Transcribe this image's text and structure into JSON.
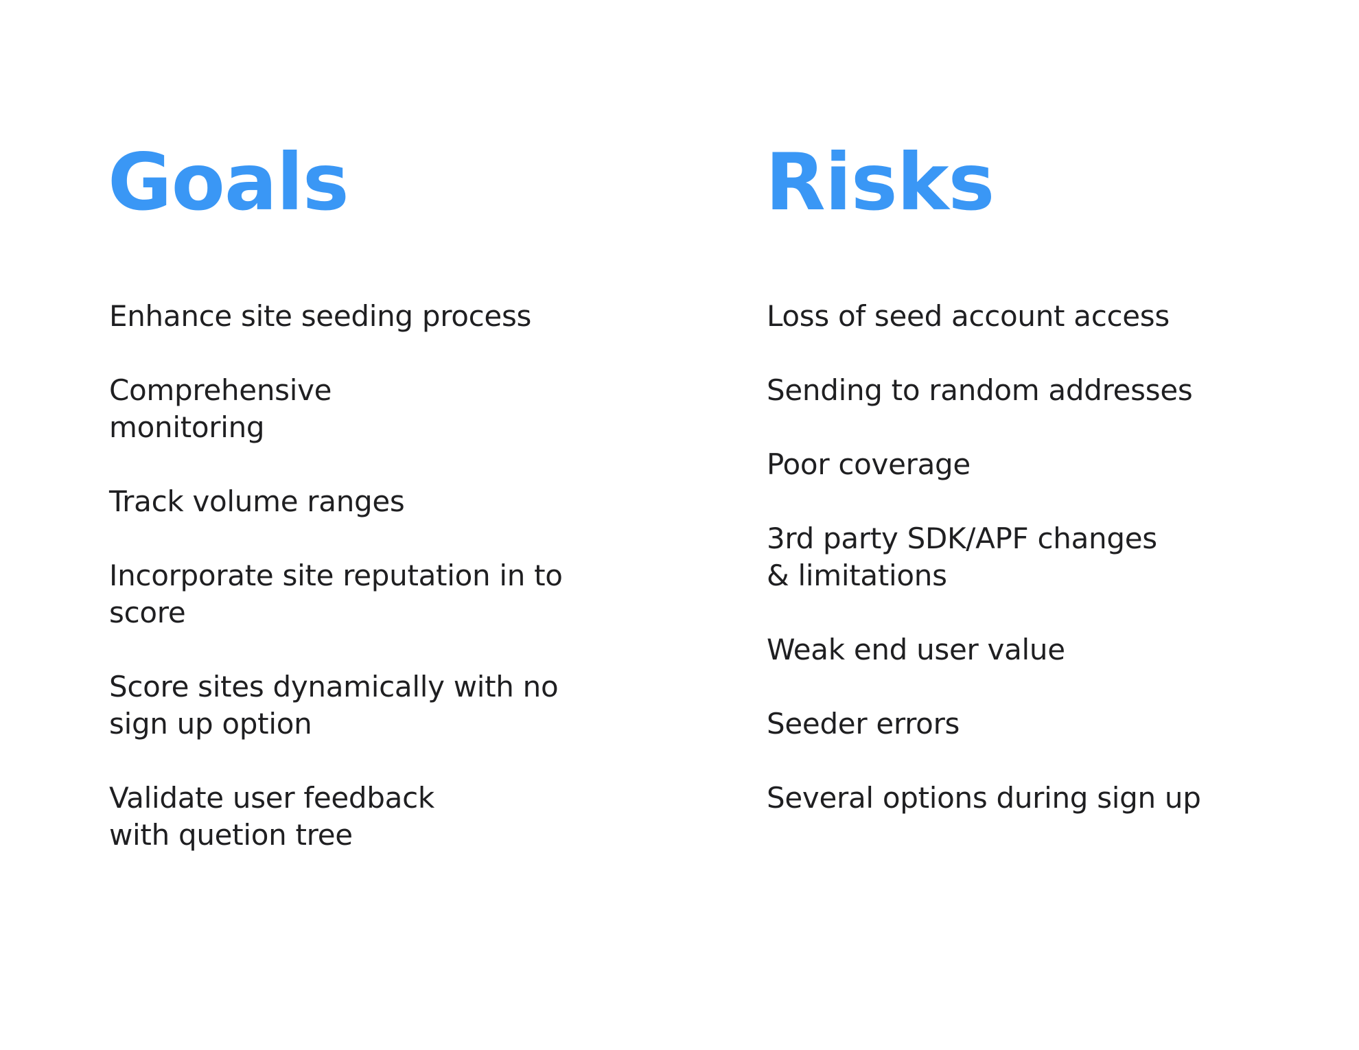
{
  "accent_color": "#3a97f5",
  "text_color": "#1f1f21",
  "goals": {
    "title": "Goals",
    "items": [
      {
        "lines": [
          "Enhance site seeding process"
        ]
      },
      {
        "lines": [
          "Comprehensive",
          "monitoring"
        ]
      },
      {
        "lines": [
          "Track volume ranges"
        ]
      },
      {
        "lines": [
          "Incorporate site reputation in  to",
          "score"
        ]
      },
      {
        "lines": [
          "Score sites dynamically with no",
          "sign up option"
        ]
      },
      {
        "lines": [
          "Validate user feedback",
          "with quetion tree"
        ]
      }
    ]
  },
  "risks": {
    "title": "Risks",
    "items": [
      {
        "lines": [
          "Loss of seed account access"
        ]
      },
      {
        "lines": [
          "Sending to random addresses"
        ]
      },
      {
        "lines": [
          "Poor coverage"
        ]
      },
      {
        "lines": [
          "3rd party SDK/APF changes",
          "& limitations"
        ]
      },
      {
        "lines": [
          "Weak end user value"
        ]
      },
      {
        "lines": [
          "Seeder errors"
        ]
      },
      {
        "lines": [
          "Several options during sign up"
        ]
      }
    ]
  }
}
